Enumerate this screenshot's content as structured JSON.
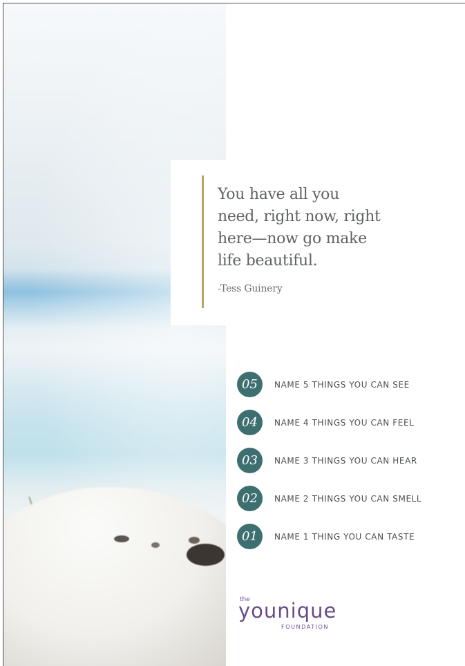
{
  "quote": {
    "lines": [
      "You have all you",
      "need, right now, right",
      "here—now go make",
      "life beautiful."
    ],
    "author": "-Tess Guinery"
  },
  "steps": [
    {
      "number": "05",
      "label": "NAME 5 THINGS YOU CAN SEE"
    },
    {
      "number": "04",
      "label": "NAME 4 THINGS YOU CAN FEEL"
    },
    {
      "number": "03",
      "label": "NAME 3 THINGS YOU CAN HEAR"
    },
    {
      "number": "02",
      "label": "NAME 2 THINGS YOU CAN SMELL"
    },
    {
      "number": "01",
      "label": "NAME 1 THING YOU CAN TASTE"
    }
  ],
  "logo": {
    "the": "the",
    "word": "younique",
    "sub": "FOUNDATION"
  },
  "colors": {
    "accent_teal": "#3e6f70",
    "quote_rule_gold": "#b5a46b",
    "logo_purple": "#6a4b86",
    "text_gray": "#5f6263"
  },
  "image": {
    "icon": "beach-photo-icon"
  }
}
